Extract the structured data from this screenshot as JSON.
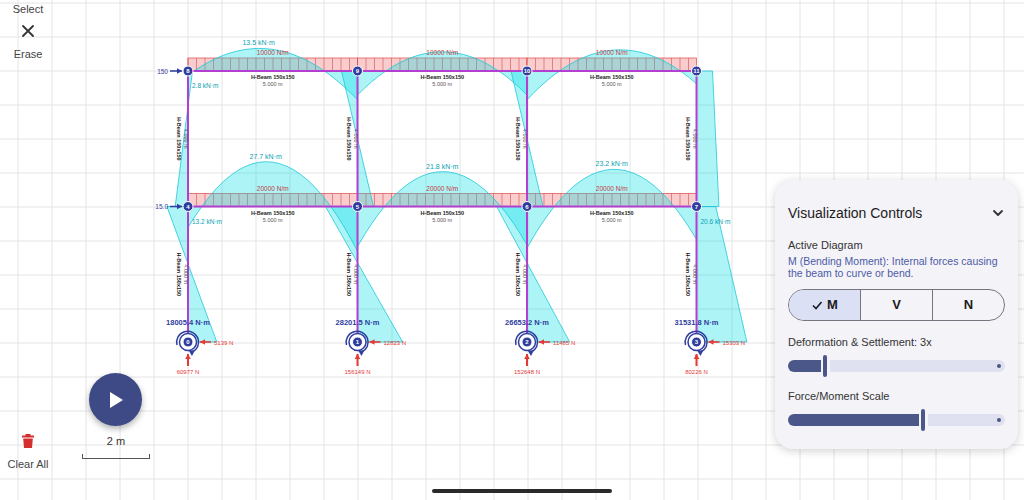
{
  "toolbar": {
    "tools": [
      {
        "label": "Select"
      },
      {
        "label": "Erase"
      }
    ],
    "clear_all": {
      "label": "Clear All"
    }
  },
  "scale_bar": {
    "label": "2 m"
  },
  "frame": {
    "nodes": [
      "0",
      "1",
      "2",
      "3",
      "4",
      "5",
      "6",
      "7",
      "8",
      "9",
      "10",
      "11"
    ],
    "members": [
      {
        "from": 4,
        "to": 5,
        "section": "H-Beam 150x150",
        "length": "5.000 m",
        "load": "20000 N/m",
        "moment": [
          -13.2,
          27.7,
          -28
        ],
        "peak_label": "27.7 kN·m"
      },
      {
        "from": 5,
        "to": 6,
        "section": "H-Beam 150x150",
        "length": "5.000 m",
        "load": "20000 N/m",
        "moment": [
          -25,
          21.8,
          -24
        ],
        "peak_label": "21.8 kN·m"
      },
      {
        "from": 6,
        "to": 7,
        "section": "H-Beam 150x150",
        "length": "5.000 m",
        "load": "20000 N/m",
        "moment": [
          -26,
          23.2,
          -20.6
        ],
        "peak_label": "23.2 kN·m"
      },
      {
        "from": 8,
        "to": 9,
        "section": "H-Beam 150x150",
        "length": "5.000 m",
        "load": "10000 N/m",
        "moment": [
          -2.8,
          13.5,
          -18
        ],
        "peak_label": "13.5 kN·m"
      },
      {
        "from": 9,
        "to": 10,
        "section": "H-Beam 150x150",
        "length": "5.000 m",
        "load": "10000 N/m",
        "moment": [
          -15,
          12,
          -15
        ]
      },
      {
        "from": 10,
        "to": 11,
        "section": "H-Beam 150x150",
        "length": "5.000 m",
        "load": "10000 N/m",
        "moment": [
          -18,
          13,
          -8
        ]
      },
      {
        "from": 0,
        "to": 4,
        "section": "H-Beam 150x150",
        "length": "4.000 m",
        "moment": [
          18.0,
          -13.2
        ]
      },
      {
        "from": 1,
        "to": 5,
        "section": "H-Beam 150x150",
        "length": "4.000 m",
        "moment": [
          28.2,
          -20
        ]
      },
      {
        "from": 2,
        "to": 6,
        "section": "H-Beam 150x150",
        "length": "4.000 m",
        "moment": [
          26.7,
          -19
        ]
      },
      {
        "from": 3,
        "to": 7,
        "section": "H-Beam 150x150",
        "length": "4.000 m",
        "moment": [
          31.5,
          12
        ]
      },
      {
        "from": 4,
        "to": 8,
        "section": "H-Beam 150x150",
        "length": "4.000 m",
        "moment": [
          -8,
          2.8
        ]
      },
      {
        "from": 5,
        "to": 9,
        "section": "H-Beam 150x150",
        "length": "4.000 m",
        "moment": [
          10,
          -10
        ]
      },
      {
        "from": 6,
        "to": 10,
        "section": "H-Beam 150x150",
        "length": "4.000 m",
        "moment": [
          10,
          -10
        ]
      },
      {
        "from": 7,
        "to": 11,
        "section": "H-Beam 150x150",
        "length": "4.000 m",
        "moment": [
          14,
          10
        ]
      }
    ],
    "point_loads": [
      {
        "node": 8,
        "label": "150"
      },
      {
        "node": 4,
        "label": "15.0"
      }
    ],
    "node_labels": [
      {
        "node": 8,
        "text": "2.8 kN·m"
      },
      {
        "node": 4,
        "text": "13.2 kN·m"
      },
      {
        "node": 7,
        "text": "20.6 kN·m"
      }
    ],
    "supports": [
      {
        "node": 0,
        "moment": "18005.4 N·m",
        "horizontal": "5139 N",
        "vertical": "60977 N"
      },
      {
        "node": 1,
        "moment": "28201.5 N·m",
        "horizontal": "12823 N",
        "vertical": "156149 N"
      },
      {
        "node": 2,
        "moment": "26653.2 N·m",
        "horizontal": "11485 N",
        "vertical": "152648 N"
      },
      {
        "node": 3,
        "moment": "31531.8 N·m",
        "horizontal": "15303 N",
        "vertical": "80226 N"
      }
    ]
  },
  "panel": {
    "title": "Visualization Controls",
    "active_diagram": {
      "label": "Active Diagram",
      "description": "M (Bending Moment): Internal forces causing the beam to curve or bend."
    },
    "diagram_types": [
      {
        "label": "M",
        "selected": true
      },
      {
        "label": "V",
        "selected": false
      },
      {
        "label": "N",
        "selected": false
      }
    ],
    "sliders": [
      {
        "label": "Deformation & Settlement: 3x",
        "level": 0.17
      },
      {
        "label": "Force/Moment Scale",
        "level": 0.62
      }
    ]
  }
}
